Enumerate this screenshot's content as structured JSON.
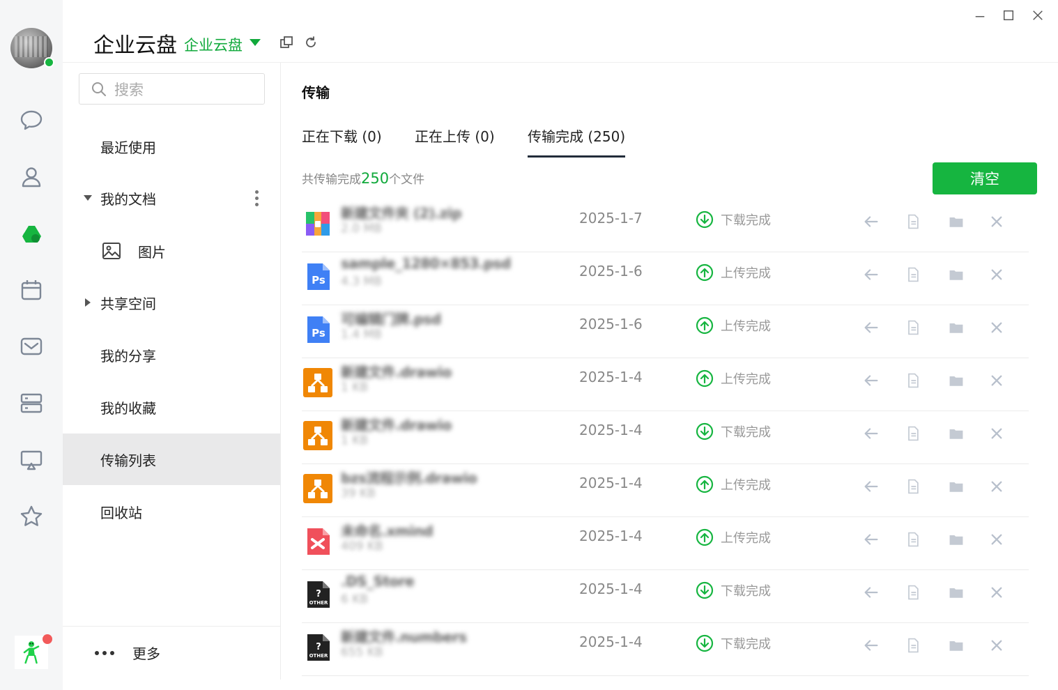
{
  "header": {
    "title": "企业云盘",
    "space_name": "企业云盘"
  },
  "search": {
    "placeholder": "搜索"
  },
  "nav": {
    "recent": "最近使用",
    "my_docs": "我的文档",
    "pictures": "图片",
    "shared_space": "共享空间",
    "my_shares": "我的分享",
    "favorites": "我的收藏",
    "transfers": "传输列表",
    "recycle": "回收站",
    "more": "更多"
  },
  "main": {
    "title": "传输",
    "tabs": [
      {
        "label": "正在下载 (0)"
      },
      {
        "label": "正在上传 (0)"
      },
      {
        "label": "传输完成 (250)"
      }
    ],
    "summary_prefix": "共传输完成",
    "summary_count": "250",
    "summary_suffix": "个文件",
    "clear_label": "清空"
  },
  "transfers": [
    {
      "icon": "zip-file-icon",
      "name": "新建文件夹 (2).zip",
      "size": "2.0 MB",
      "date": "2025-1-7",
      "status": "下载完成",
      "direction": "download"
    },
    {
      "icon": "psd-file-icon",
      "name": "sample_1280×853.psd",
      "size": "4.3 MB",
      "date": "2025-1-6",
      "status": "上传完成",
      "direction": "upload"
    },
    {
      "icon": "psd-file-icon",
      "name": "可编辑门牌.psd",
      "size": "1.4 MB",
      "date": "2025-1-6",
      "status": "上传完成",
      "direction": "upload"
    },
    {
      "icon": "drawio-file-icon",
      "name": "新建文件.drawio",
      "size": "1 KB",
      "date": "2025-1-4",
      "status": "上传完成",
      "direction": "upload"
    },
    {
      "icon": "drawio-file-icon",
      "name": "新建文件.drawio",
      "size": "1 KB",
      "date": "2025-1-4",
      "status": "下载完成",
      "direction": "download"
    },
    {
      "icon": "drawio-file-icon",
      "name": "bzs流程示例.drawio",
      "size": "39 KB",
      "date": "2025-1-4",
      "status": "上传完成",
      "direction": "upload"
    },
    {
      "icon": "xmind-file-icon",
      "name": "未命名.xmind",
      "size": "409 KB",
      "date": "2025-1-4",
      "status": "上传完成",
      "direction": "upload"
    },
    {
      "icon": "other-file-icon",
      "name": ".DS_Store",
      "size": "6 KB",
      "date": "2025-1-4",
      "status": "下载完成",
      "direction": "download"
    },
    {
      "icon": "other-file-icon",
      "name": "新建文件.numbers",
      "size": "655 KB",
      "date": "2025-1-4",
      "status": "下载完成",
      "direction": "download"
    }
  ],
  "colors": {
    "brand_green": "#16b540",
    "accent_green": "#10a93b",
    "muted": "#999999"
  }
}
